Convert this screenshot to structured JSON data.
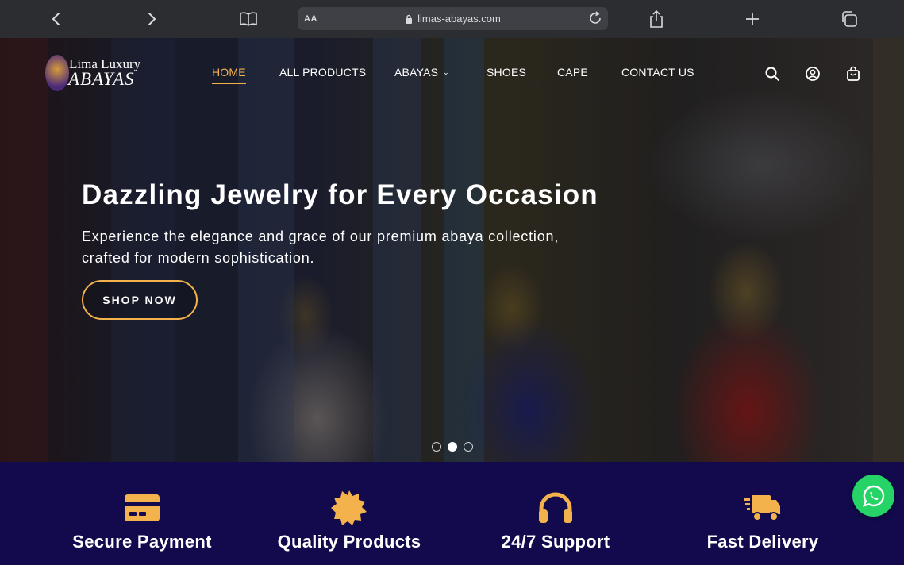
{
  "browser": {
    "reader_label": "AA",
    "url": "limas-abayas.com"
  },
  "brand": {
    "line1": "Lima Luxury",
    "line2": "ABAYAS"
  },
  "nav": {
    "items": [
      {
        "label": "HOME",
        "active": true
      },
      {
        "label": "ALL PRODUCTS",
        "active": false
      },
      {
        "label": "ABAYAS",
        "active": false,
        "has_dropdown": true
      },
      {
        "label": "SHOES",
        "active": false
      },
      {
        "label": "CAPE",
        "active": false
      },
      {
        "label": "CONTACT US",
        "active": false
      }
    ],
    "tools": [
      "search-icon",
      "user-icon",
      "cart-icon"
    ]
  },
  "hero": {
    "title": "Dazzling Jewelry for Every Occasion",
    "subtitle": "Experience the elegance and grace of our premium abaya collection, crafted for modern sophistication.",
    "cta_label": "SHOP NOW",
    "slides_total": 3,
    "slide_active": 2
  },
  "features": [
    {
      "label": "Secure Payment",
      "icon": "credit-card-icon"
    },
    {
      "label": "Quality Products",
      "icon": "badge-icon"
    },
    {
      "label": "24/7 Support",
      "icon": "headphones-icon"
    },
    {
      "label": "Fast Delivery",
      "icon": "truck-icon"
    }
  ],
  "colors": {
    "accent": "#f3b24c",
    "features_bg": "#130a4d",
    "whatsapp": "#25d366"
  }
}
